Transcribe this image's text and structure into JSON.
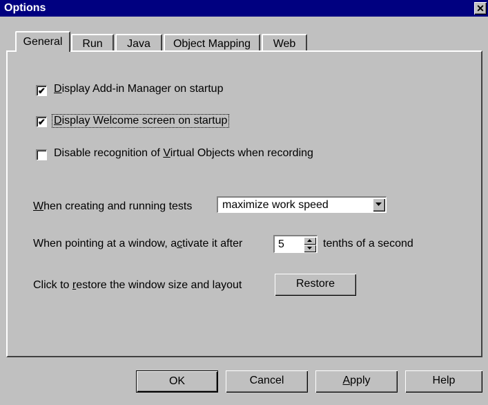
{
  "window": {
    "title": "Options",
    "close_glyph": "✕"
  },
  "tabs": [
    {
      "label": "General",
      "active": true
    },
    {
      "label": "Run",
      "active": false
    },
    {
      "label": "Java",
      "active": false
    },
    {
      "label": "Object Mapping",
      "active": false
    },
    {
      "label": "Web",
      "active": false
    }
  ],
  "general": {
    "checkboxes": [
      {
        "label_pre": "",
        "label_key": "D",
        "label_post": "isplay Add-in Manager on startup",
        "checked": true
      },
      {
        "label_pre": "",
        "label_key": "D",
        "label_post": "isplay Welcome screen on startup",
        "checked": true
      },
      {
        "label_pre": "Disable recognition of ",
        "label_key": "V",
        "label_post": "irtual Objects when recording",
        "checked": false
      }
    ],
    "run_mode": {
      "label_key": "W",
      "label_post": "hen creating and running tests",
      "value": "maximize work speed"
    },
    "activate": {
      "label_pre": "When pointing at a window, a",
      "label_key": "c",
      "label_post": "tivate  it after",
      "value": "5",
      "unit": "tenths of a second"
    },
    "restore": {
      "label_pre": "Click to ",
      "label_key": "r",
      "label_post": "estore the window size and layout",
      "button": "Restore"
    }
  },
  "buttons": {
    "ok": "OK",
    "cancel": "Cancel",
    "apply_key": "A",
    "apply_post": "pply",
    "help": "Help"
  },
  "check_glyph": "✔"
}
